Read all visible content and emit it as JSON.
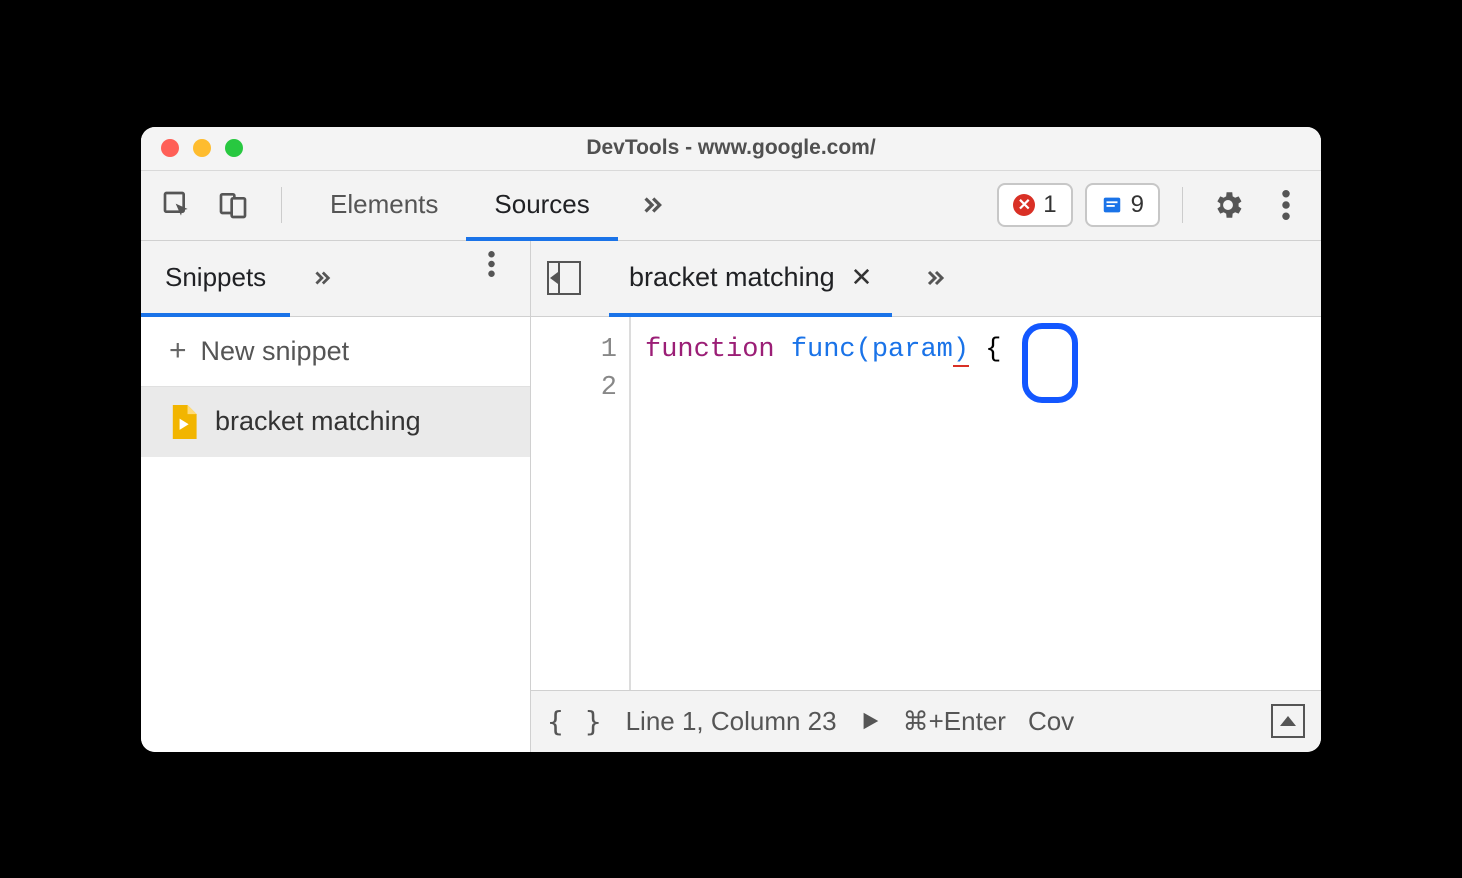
{
  "window": {
    "title": "DevTools - www.google.com/"
  },
  "toolbar": {
    "tabs": [
      "Elements",
      "Sources"
    ],
    "active_tab": "Sources",
    "errors_count": "1",
    "issues_count": "9"
  },
  "sidebar": {
    "tab_label": "Snippets",
    "new_snippet_label": "New snippet",
    "items": [
      {
        "name": "bracket matching"
      }
    ]
  },
  "editor": {
    "tab_label": "bracket matching",
    "gutter": [
      "1",
      "2"
    ],
    "code": {
      "keyword": "function",
      "space1": " ",
      "func_name": "func",
      "open_paren": "(",
      "param": "param",
      "close_paren": ")",
      "space2": " ",
      "open_brace": "{"
    }
  },
  "status": {
    "position": "Line 1, Column 23",
    "shortcut": "⌘+Enter",
    "coverage": "Cov"
  }
}
